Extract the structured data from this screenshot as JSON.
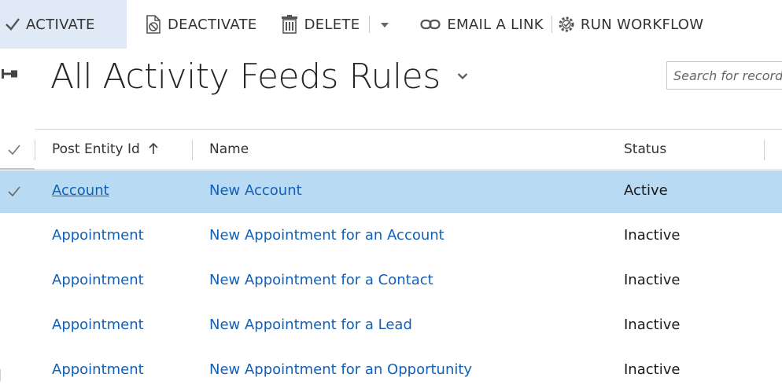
{
  "toolbar": {
    "activate_label": "ACTIVATE",
    "deactivate_label": "DEACTIVATE",
    "delete_label": "DELETE",
    "email_link_label": "EMAIL A LINK",
    "run_workflow_label": "RUN WORKFLOW",
    "icons": {
      "activate": "checkmark-icon",
      "deactivate": "document-deactivate-icon",
      "delete": "trash-icon",
      "more": "chevron-down-icon",
      "email_link": "link-icon",
      "run_workflow": "workflow-gear-icon"
    }
  },
  "header": {
    "pin_icon": "pin-icon",
    "view_title": "All Activity Feeds Rules",
    "view_selector_icon": "chevron-down-icon",
    "search_placeholder": "Search for records"
  },
  "grid": {
    "columns": [
      {
        "label": "Post Entity Id",
        "sort": "ascending",
        "sort_icon": "arrow-up-icon"
      },
      {
        "label": "Name"
      },
      {
        "label": "Status"
      }
    ],
    "rows": [
      {
        "post_entity_id": "Account",
        "name": "New Account",
        "status": "Active",
        "selected": true
      },
      {
        "post_entity_id": "Appointment",
        "name": "New Appointment for an Account",
        "status": "Inactive",
        "selected": false
      },
      {
        "post_entity_id": "Appointment",
        "name": "New Appointment for a Contact",
        "status": "Inactive",
        "selected": false
      },
      {
        "post_entity_id": "Appointment",
        "name": "New Appointment for a Lead",
        "status": "Inactive",
        "selected": false
      },
      {
        "post_entity_id": "Appointment",
        "name": "New Appointment for an Opportunity",
        "status": "Inactive",
        "selected": false
      }
    ]
  },
  "colors": {
    "link": "#1160b7",
    "selected_row": "#b9daf3",
    "toolbar_highlight": "#dfeaf6",
    "text": "#262626"
  }
}
